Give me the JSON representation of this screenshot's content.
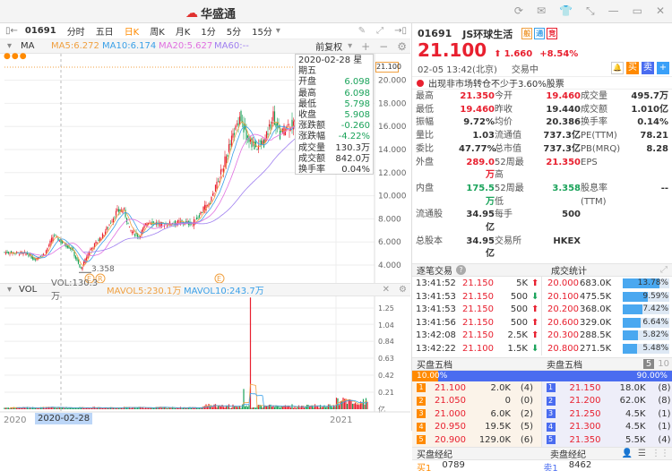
{
  "app": {
    "name": "华盛通"
  },
  "window_icons": [
    "refresh-icon",
    "mail-icon",
    "shirt-icon",
    "collapse-icon",
    "minimize-icon",
    "maximize-icon",
    "close-icon"
  ],
  "toolbar": {
    "code": "01691",
    "periods": [
      "分时",
      "五日",
      "日K",
      "周K",
      "月K",
      "1分",
      "5分",
      "15分"
    ],
    "active": "日K"
  },
  "ma": {
    "label": "MA",
    "ma5": "MA5:6.272",
    "ma10": "MA10:6.174",
    "ma20": "MA20:5.627",
    "ma60": "MA60:--",
    "adjust": "前复权"
  },
  "colors": {
    "ma5": "#f0a040",
    "ma10": "#3aa0e8",
    "ma20": "#e070e0",
    "ma60": "#a080f0",
    "up": "#e8202f",
    "down": "#1aa35a",
    "accent": "#ff8a00"
  },
  "price_axis": [
    "20.000",
    "18.000",
    "16.000",
    "14.000",
    "12.000",
    "10.000",
    "8.000",
    "6.000",
    "4.000"
  ],
  "current_price_tag": "21.100",
  "low_label": "3.358",
  "event_markers": [
    "E",
    "R",
    "E"
  ],
  "tooltip": {
    "date": "2020-02-28 星期五",
    "rows": [
      [
        "开盘",
        "6.098"
      ],
      [
        "最高",
        "6.098"
      ],
      [
        "最低",
        "5.798"
      ],
      [
        "收盘",
        "5.908"
      ],
      [
        "涨跌额",
        "-0.260"
      ],
      [
        "涨跌幅",
        "-4.22%"
      ],
      [
        "成交量",
        "130.3万"
      ],
      [
        "成交额",
        "842.0万"
      ],
      [
        "换手率",
        "0.04%"
      ]
    ]
  },
  "vol": {
    "label": "VOL",
    "vol": "VOL:130.3万",
    "mavol5": "MAVOL5:230.1万",
    "mavol10": "MAVOL10:243.7万",
    "axis": [
      "1.25",
      "1.04",
      "0.84",
      "0.63",
      "0.42",
      "0.21",
      "亿"
    ]
  },
  "date_axis": {
    "start": "2020",
    "cursor": "2020-02-28",
    "end": "2021"
  },
  "quote": {
    "code": "01691",
    "name": "JS环球生活",
    "badges": [
      "般",
      "通",
      "竞"
    ],
    "price": "21.100",
    "change": "1.660",
    "pct": "+8.54%",
    "time": "02-05  13:42(北京)",
    "status": "交易中",
    "buy": "买",
    "sell": "卖",
    "add": "+",
    "notice": "出现非市场转仓不少于3.60%股票"
  },
  "stats": [
    [
      "最高",
      "21.350",
      "今开",
      "19.460",
      "成交量",
      "495.7万"
    ],
    [
      "最低",
      "19.460",
      "昨收",
      "19.440",
      "成交额",
      "1.010亿"
    ],
    [
      "振幅",
      "9.72%",
      "均价",
      "20.386",
      "换手率",
      "0.14%"
    ],
    [
      "量比",
      "1.03",
      "流通值",
      "737.3亿",
      "PE(TTM)",
      "78.21"
    ],
    [
      "委比",
      "47.77%",
      "总市值",
      "737.3亿",
      "PB(MRQ)",
      "8.28"
    ],
    [
      "外盘",
      "289.0万",
      "52周最高",
      "21.350",
      "EPS",
      ""
    ],
    [
      "内盘",
      "175.5万",
      "52周最低",
      "3.358",
      "股息率(TTM)",
      "--"
    ],
    [
      "流通股",
      "34.95亿",
      "每手",
      "500",
      "",
      ""
    ],
    [
      "总股本",
      "34.95亿",
      "交易所",
      "HKEX",
      "",
      ""
    ]
  ],
  "ticks": {
    "title": "逐笔交易",
    "rows": [
      [
        "13:41:52",
        "21.150",
        "5K",
        "up"
      ],
      [
        "13:41:53",
        "21.150",
        "500",
        "down"
      ],
      [
        "13:41:53",
        "21.150",
        "500",
        "up"
      ],
      [
        "13:41:56",
        "21.150",
        "500",
        "up"
      ],
      [
        "13:42:08",
        "21.150",
        "2.5K",
        "up"
      ],
      [
        "13:42:22",
        "21.100",
        "1.5K",
        "down"
      ]
    ]
  },
  "volstats": {
    "title": "成交统计",
    "rows": [
      [
        "20.000",
        "683.0K",
        "13.78%",
        13.78
      ],
      [
        "20.100",
        "475.5K",
        "9.59%",
        9.59
      ],
      [
        "20.200",
        "368.0K",
        "7.42%",
        7.42
      ],
      [
        "20.600",
        "329.0K",
        "6.64%",
        6.64
      ],
      [
        "20.300",
        "288.5K",
        "5.82%",
        5.82
      ],
      [
        "20.800",
        "271.5K",
        "5.48%",
        5.48
      ]
    ]
  },
  "book": {
    "bid_title": "买盘五档",
    "ask_title": "卖盘五档",
    "level5": "5",
    "level10": "10",
    "bid_pct": "10.00%",
    "ask_pct": "90.00%",
    "bid_ratio": 10,
    "bids": [
      [
        "1",
        "21.100",
        "2.0K",
        "(4)"
      ],
      [
        "2",
        "21.050",
        "0",
        "(0)"
      ],
      [
        "3",
        "21.000",
        "6.0K",
        "(2)"
      ],
      [
        "4",
        "20.950",
        "19.5K",
        "(5)"
      ],
      [
        "5",
        "20.900",
        "129.0K",
        "(6)"
      ]
    ],
    "asks": [
      [
        "1",
        "21.150",
        "18.0K",
        "(8)"
      ],
      [
        "2",
        "21.200",
        "62.0K",
        "(8)"
      ],
      [
        "3",
        "21.250",
        "4.5K",
        "(1)"
      ],
      [
        "4",
        "21.300",
        "4.5K",
        "(1)"
      ],
      [
        "5",
        "21.350",
        "5.5K",
        "(4)"
      ]
    ]
  },
  "brokers": {
    "bid_title": "买盘经纪",
    "ask_title": "卖盘经纪",
    "bid_row": [
      "买1",
      "0789"
    ],
    "ask_row": [
      "卖1",
      "8462"
    ]
  }
}
